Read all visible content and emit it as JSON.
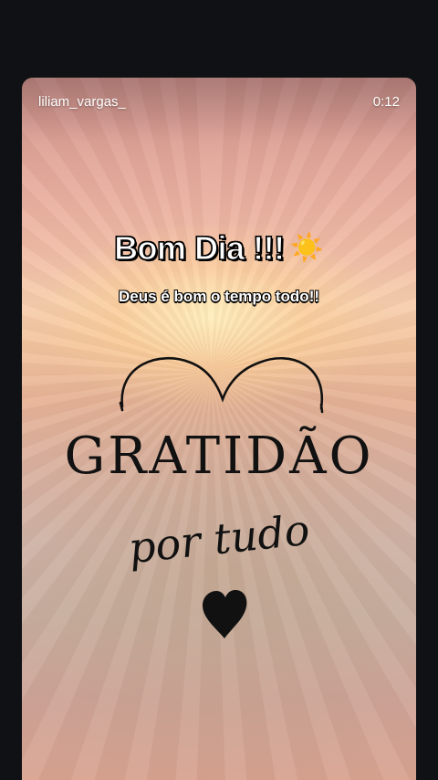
{
  "story": {
    "username": "liliam_vargas_",
    "timer": "0:12"
  },
  "content": {
    "greeting": "Bom Dia !!!",
    "greeting_emoji": "☀️",
    "subtitle": "Deus é bom o tempo todo!!",
    "title": "GRATIDÃO",
    "script_text": "por tudo"
  },
  "icons": {
    "heart": "heart-icon",
    "arc": "heart-arc-decoration"
  },
  "colors": {
    "background": "#101114",
    "text_light": "#ffffff",
    "text_dark": "#111111"
  }
}
